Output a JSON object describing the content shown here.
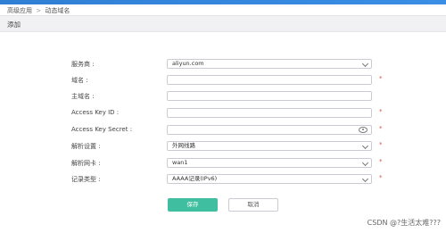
{
  "breadcrumb": {
    "parent": "高级应用",
    "separator": ">",
    "current": "动态域名"
  },
  "section": {
    "title": "添加"
  },
  "form": {
    "provider": {
      "label": "服务商 :",
      "value": "aliyun.com"
    },
    "domain": {
      "label": "域名 :",
      "value": "",
      "required_mark": "*"
    },
    "host": {
      "label": "主域名 :",
      "value": ""
    },
    "access_key_id": {
      "label": "Access Key ID :",
      "value": "",
      "required_mark": "*"
    },
    "access_key_secret": {
      "label": "Access Key Secret :",
      "value": "",
      "required_mark": "*"
    },
    "resolve_setting": {
      "label": "解析设置 :",
      "value": "外网线路",
      "required_mark": "*"
    },
    "resolve_nic": {
      "label": "解析网卡 :",
      "value": "wan1",
      "required_mark": "*"
    },
    "record_type": {
      "label": "记录类型 :",
      "value": "AAAA记录(IPv6)",
      "required_mark": "*"
    }
  },
  "buttons": {
    "save": "保存",
    "cancel": "取消"
  },
  "watermark": "CSDN @?生活太难???",
  "colors": {
    "accent": "#3a8ee6",
    "save_button": "#3fbf9f",
    "required": "#e04b4b"
  }
}
